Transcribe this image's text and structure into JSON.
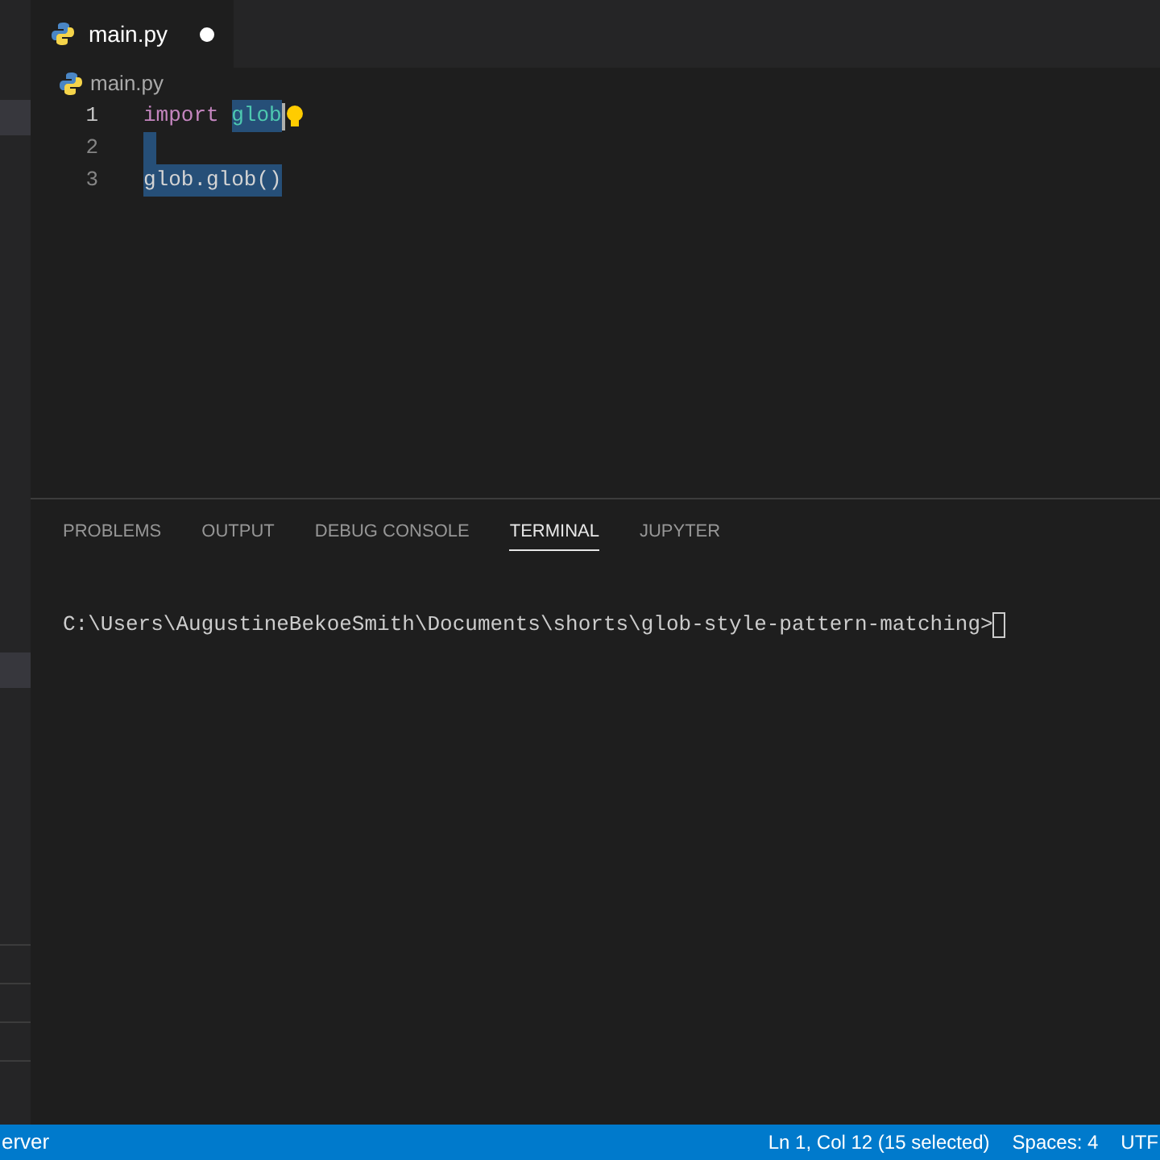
{
  "editor_tabs": [
    {
      "label": "main.py",
      "selected": true,
      "modified": true
    }
  ],
  "breadcrumb": "main.py",
  "code_lines": [
    {
      "number": "1",
      "current": true,
      "tokens": [
        {
          "kind": "keyword",
          "text": "import ",
          "selected": false
        },
        {
          "kind": "module",
          "text": "glob",
          "selected": true
        }
      ],
      "cursor": true,
      "lightbulb": true
    },
    {
      "number": "2",
      "current": false,
      "blank_selected": true
    },
    {
      "number": "3",
      "current": false,
      "tokens": [
        {
          "kind": "plain",
          "text": "glob.glob()",
          "selected": true
        }
      ]
    }
  ],
  "panel_tabs": [
    {
      "label": "PROBLEMS",
      "selected": false
    },
    {
      "label": "OUTPUT",
      "selected": false
    },
    {
      "label": "DEBUG CONSOLE",
      "selected": false
    },
    {
      "label": "TERMINAL",
      "selected": true
    },
    {
      "label": "JUPYTER",
      "selected": false
    }
  ],
  "terminal": {
    "prompt": "C:\\Users\\AugustineBekoeSmith\\Documents\\shorts\\glob-style-pattern-matching>"
  },
  "status_bar": {
    "left": "erver",
    "right": [
      "Ln 1, Col 12 (15 selected)",
      "Spaces: 4",
      "UTF"
    ]
  }
}
